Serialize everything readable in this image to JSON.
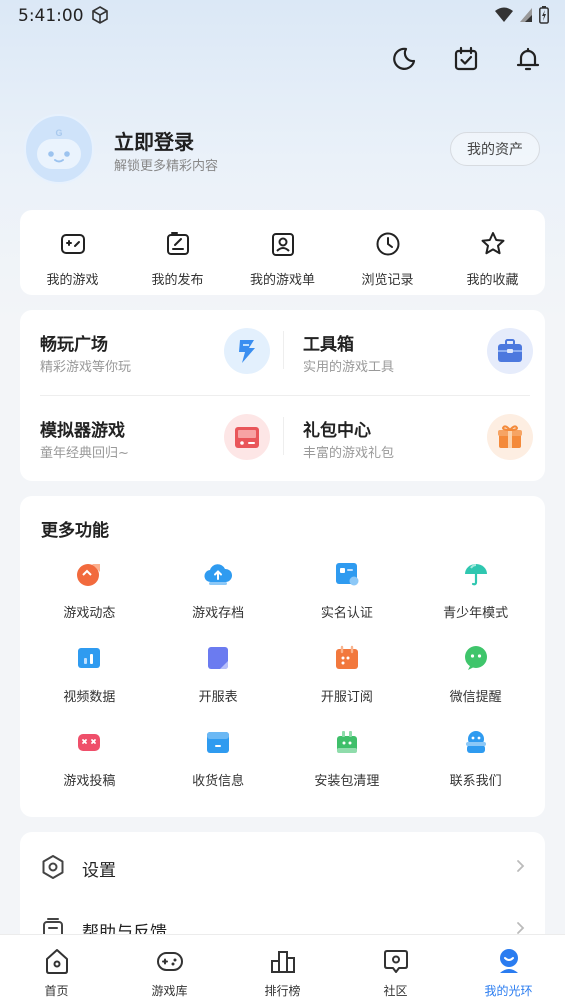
{
  "status": {
    "time": "5:41:00"
  },
  "profile": {
    "title": "立即登录",
    "subtitle": "解锁更多精彩内容",
    "assets_button": "我的资产"
  },
  "quick": [
    {
      "label": "我的游戏",
      "icon": "gamepad-icon"
    },
    {
      "label": "我的发布",
      "icon": "publish-icon"
    },
    {
      "label": "我的游戏单",
      "icon": "game-list-icon"
    },
    {
      "label": "浏览记录",
      "icon": "clock-icon"
    },
    {
      "label": "我的收藏",
      "icon": "star-icon"
    }
  ],
  "services": [
    {
      "title": "畅玩广场",
      "subtitle": "精彩游戏等你玩",
      "icon": "lightning-icon",
      "color": "#3a8ef0"
    },
    {
      "title": "工具箱",
      "subtitle": "实用的游戏工具",
      "icon": "toolbox-icon",
      "color": "#4c78de"
    },
    {
      "title": "模拟器游戏",
      "subtitle": "童年经典回归~",
      "icon": "emulator-icon",
      "color": "#e9565a"
    },
    {
      "title": "礼包中心",
      "subtitle": "丰富的游戏礼包",
      "icon": "gift-icon",
      "color": "#f48a3a"
    }
  ],
  "more": {
    "title": "更多功能",
    "items": [
      {
        "label": "游戏动态",
        "icon": "game-news-icon",
        "color": "#f26a3d"
      },
      {
        "label": "游戏存档",
        "icon": "cloud-save-icon",
        "color": "#2f9bf0"
      },
      {
        "label": "实名认证",
        "icon": "id-card-icon",
        "color": "#2f9bf0"
      },
      {
        "label": "青少年模式",
        "icon": "umbrella-icon",
        "color": "#2fc7b0"
      },
      {
        "label": "视频数据",
        "icon": "video-data-icon",
        "color": "#2f9bf0"
      },
      {
        "label": "开服表",
        "icon": "server-table-icon",
        "color": "#6b7bf0"
      },
      {
        "label": "开服订阅",
        "icon": "calendar-icon",
        "color": "#f2783d"
      },
      {
        "label": "微信提醒",
        "icon": "wechat-icon",
        "color": "#3fc56b"
      },
      {
        "label": "游戏投稿",
        "icon": "game-submit-icon",
        "color": "#ef4f6a"
      },
      {
        "label": "收货信息",
        "icon": "address-icon",
        "color": "#2f9bf0"
      },
      {
        "label": "安装包清理",
        "icon": "clean-icon",
        "color": "#3fbf6a"
      },
      {
        "label": "联系我们",
        "icon": "contact-icon",
        "color": "#2f9bf0"
      }
    ]
  },
  "settings": [
    {
      "label": "设置",
      "icon": "settings-icon"
    },
    {
      "label": "帮助与反馈",
      "icon": "help-icon"
    }
  ],
  "nav": [
    {
      "label": "首页",
      "icon": "home-icon"
    },
    {
      "label": "游戏库",
      "icon": "game-library-icon"
    },
    {
      "label": "排行榜",
      "icon": "ranking-icon"
    },
    {
      "label": "社区",
      "icon": "community-icon"
    },
    {
      "label": "我的光环",
      "icon": "profile-icon",
      "active": true
    }
  ]
}
